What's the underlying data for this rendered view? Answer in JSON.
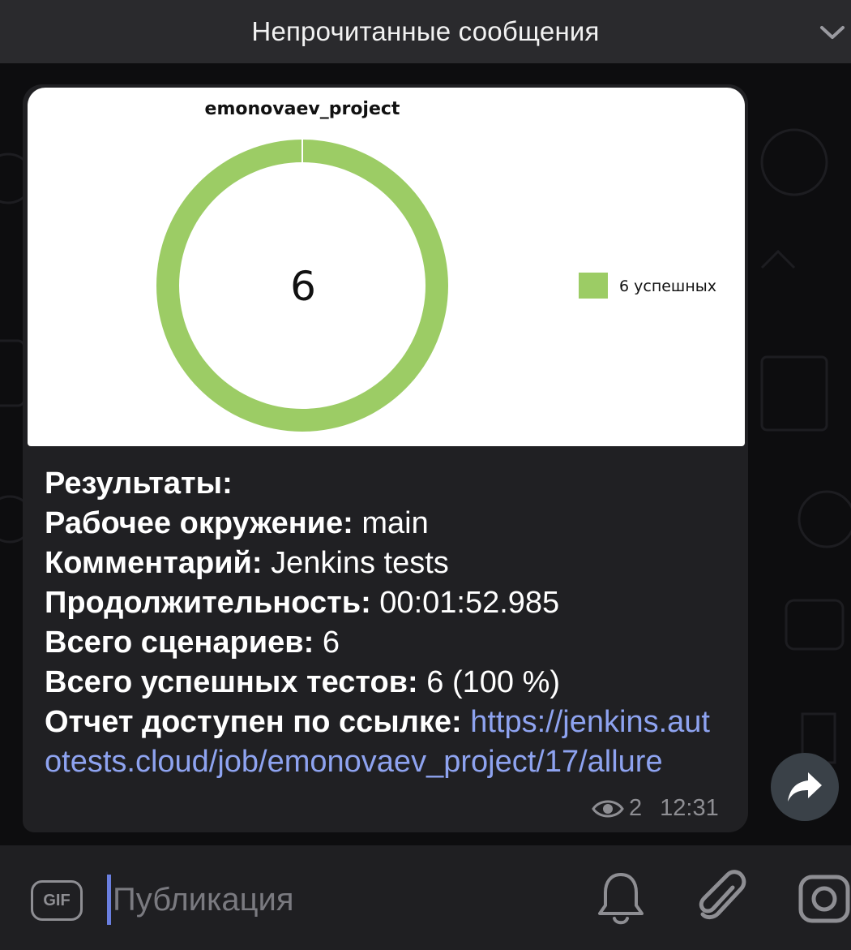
{
  "header": {
    "title": "Непрочитанные сообщения"
  },
  "message": {
    "chart_data": {
      "type": "pie",
      "title": "emonovaev_project",
      "center_label": "6",
      "slices": [
        {
          "label": "6 успешных",
          "value": 6,
          "color": "#9ccc65"
        }
      ],
      "legend_position": "right"
    },
    "lines": {
      "results_label": "Результаты:",
      "env_label": "Рабочее окружение:",
      "env_value": "main",
      "comment_label": "Комментарий:",
      "comment_value": "Jenkins tests",
      "duration_label": "Продолжительность:",
      "duration_value": "00:01:52.985",
      "scenarios_label": "Всего сценариев:",
      "scenarios_value": "6",
      "passed_label": "Всего успешных тестов:",
      "passed_value": "6 (100 %)",
      "report_label": "Отчет доступен по ссылке:",
      "report_link": "https://jenkins.autotests.cloud/job/emonovaev_project/17/allure"
    },
    "views": "2",
    "time": "12:31"
  },
  "composer": {
    "gif_label": "GIF",
    "placeholder": "Публикация"
  },
  "colors": {
    "accent_link": "#8ea3f0",
    "passed_green": "#9ccc65"
  }
}
